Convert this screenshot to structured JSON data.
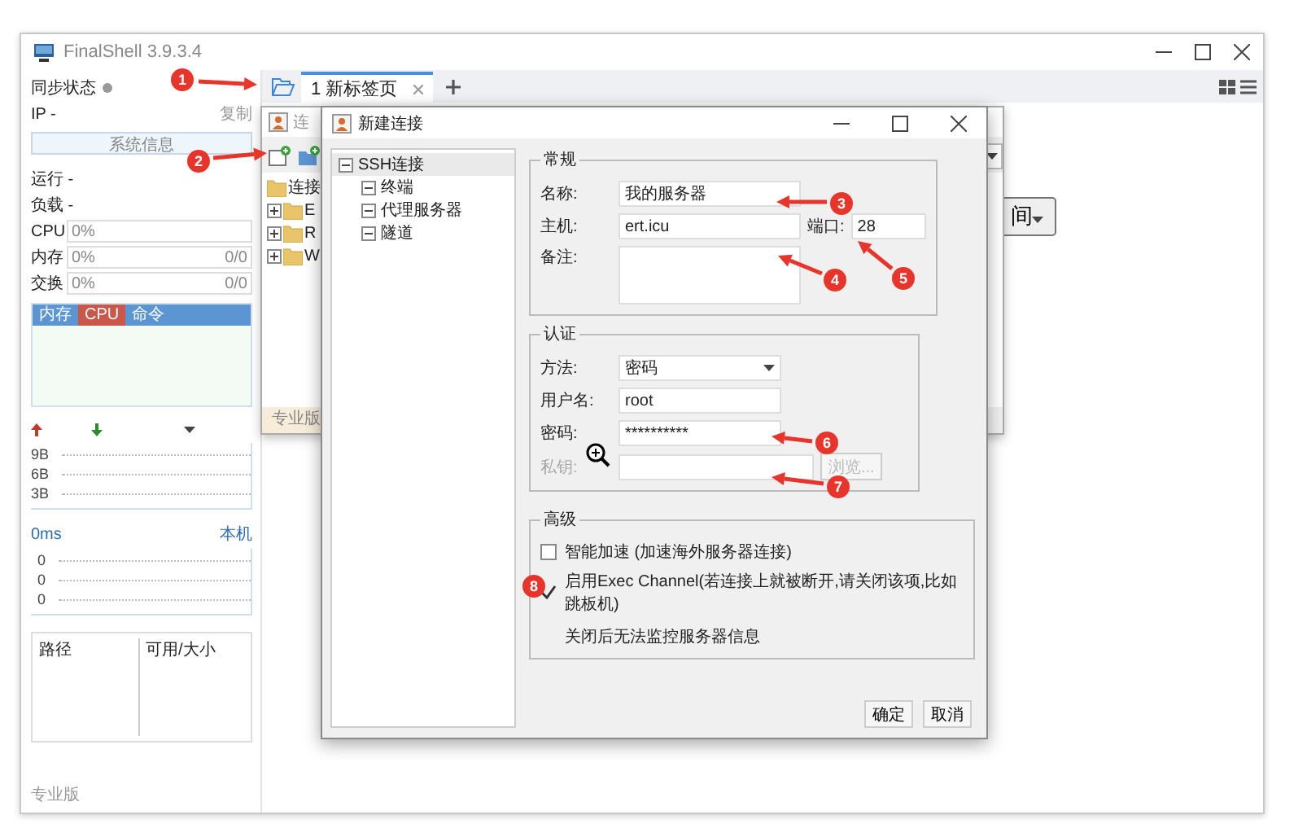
{
  "window": {
    "title": "FinalShell 3.9.3.4"
  },
  "sidebar": {
    "sync_label": "同步状态",
    "ip_label": "IP -",
    "copy_link": "复制",
    "sysinfo_button": "系统信息",
    "run_label": "运行 -",
    "load_label": "负载 -",
    "meters": [
      {
        "label": "CPU",
        "value": "0%"
      },
      {
        "label": "内存",
        "value": "0%",
        "extra": "0/0"
      },
      {
        "label": "交换",
        "value": "0%",
        "extra": "0/0"
      }
    ],
    "process_tabs": [
      {
        "label": "内存",
        "selected": false
      },
      {
        "label": "CPU",
        "selected": true
      },
      {
        "label": "命令",
        "selected": false
      }
    ],
    "net_ticks": [
      "9B",
      "6B",
      "3B"
    ],
    "latency": "0ms",
    "host": "本机",
    "latency_ticks": [
      "0",
      "0",
      "0"
    ],
    "disk_columns": [
      "路径",
      "可用/大小"
    ],
    "edition": "专业版"
  },
  "tabs": [
    {
      "label": "1 新标签页",
      "selected": true
    }
  ],
  "sort_button": "间",
  "connection_manager": {
    "title": "连",
    "folder": "连接",
    "items": [
      "E",
      "R",
      "W"
    ],
    "edition": "专业版"
  },
  "dialog": {
    "title": "新建连接",
    "tree": [
      {
        "label": "SSH连接",
        "children": [
          {
            "label": "终端"
          },
          {
            "label": "代理服务器"
          },
          {
            "label": "隧道"
          }
        ]
      }
    ],
    "general": {
      "legend": "常规",
      "name_label": "名称:",
      "name": "我的服务器",
      "host_label": "主机:",
      "host": "ert.icu",
      "port_label": "端口:",
      "port": "28",
      "note_label": "备注:"
    },
    "auth": {
      "legend": "认证",
      "method_label": "方法:",
      "method": "密码",
      "user_label": "用户名:",
      "user": "root",
      "password_label": "密码:",
      "password": "**********",
      "key_label": "私钥:",
      "browse_button": "浏览...",
      "key_disabled": true
    },
    "advanced": {
      "legend": "高级",
      "options": [
        {
          "label": "智能加速 (加速海外服务器连接)",
          "checked": false
        },
        {
          "label": "启用Exec Channel(若连接上就被断开,请关闭该项,比如跳板机)",
          "checked": true
        }
      ],
      "note": "关闭后无法监控服务器信息"
    },
    "buttons": [
      "确定",
      "取消"
    ]
  },
  "annotations": [
    {
      "number": "1"
    },
    {
      "number": "2"
    },
    {
      "number": "3"
    },
    {
      "number": "4"
    },
    {
      "number": "5"
    },
    {
      "number": "6"
    },
    {
      "number": "7"
    },
    {
      "number": "8"
    }
  ]
}
